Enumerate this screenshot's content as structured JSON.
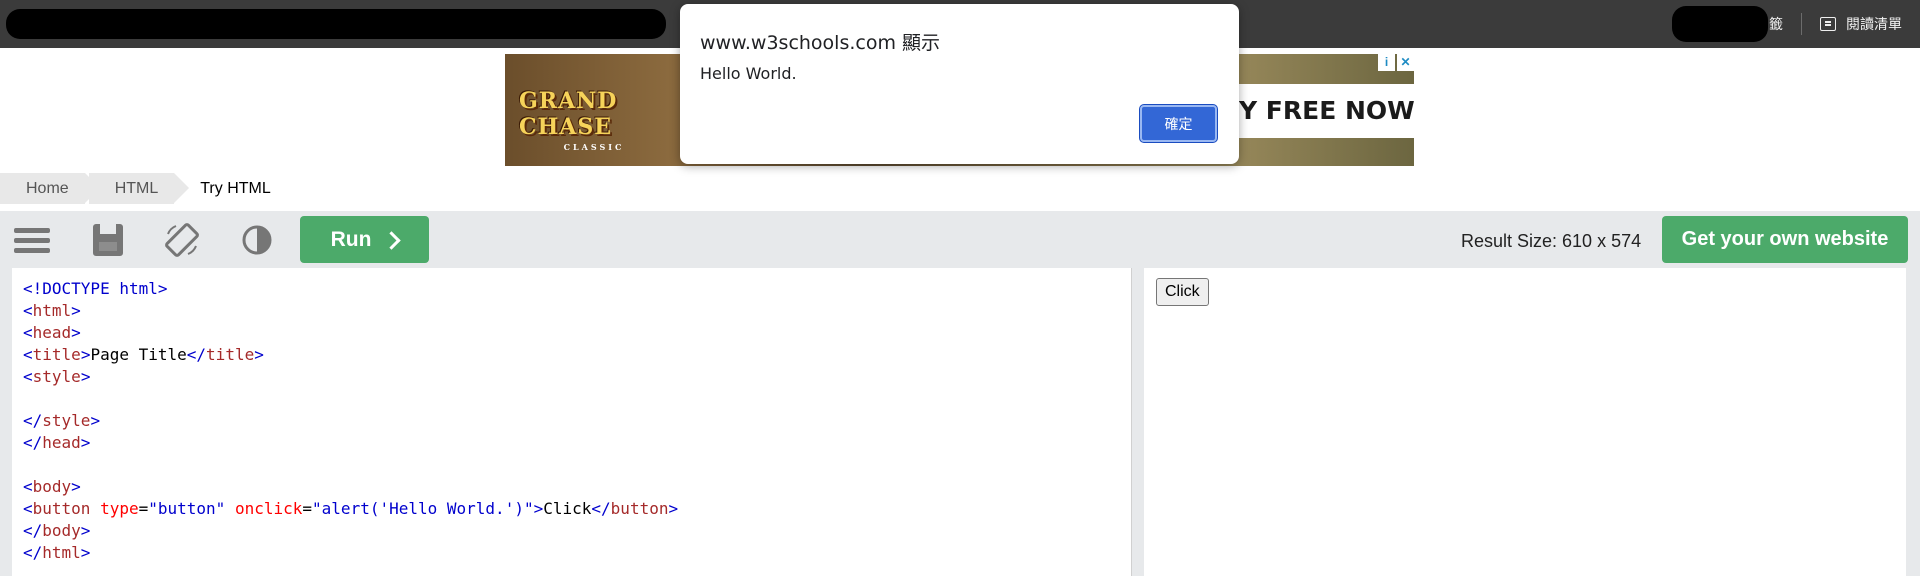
{
  "browser": {
    "reading_list_label": "閱讀清單",
    "bookmark_partial": "籤"
  },
  "ad": {
    "logo_text": "GRAND CHASE",
    "logo_sub": "CLASSIC",
    "cta_text": "Y FREE NOW",
    "info_badge": "i",
    "close_badge": "✕"
  },
  "dialog": {
    "origin": "www.w3schools.com 顯示",
    "message": "Hello World.",
    "ok_label": "確定"
  },
  "breadcrumb": [
    "Home",
    "HTML",
    "Try HTML"
  ],
  "toolbar": {
    "run_label": "Run",
    "result_size": "Result Size: 610 x 574",
    "own_site_label": "Get your own website"
  },
  "code": {
    "doctype": "<!DOCTYPE html>",
    "html": "html",
    "head": "head",
    "title": "title",
    "title_text": "Page Title",
    "style": "style",
    "body": "body",
    "button": "button",
    "attr_type": "type",
    "attr_type_val": "\"button\"",
    "attr_onclick": "onclick",
    "attr_onclick_val": "\"alert('Hello World.')\"",
    "button_text": "Click"
  },
  "result": {
    "button_label": "Click"
  },
  "colors": {
    "green": "#4caa6a",
    "dialog_ok": "#3367d6",
    "toolbar_bg": "#e7e9eb"
  }
}
